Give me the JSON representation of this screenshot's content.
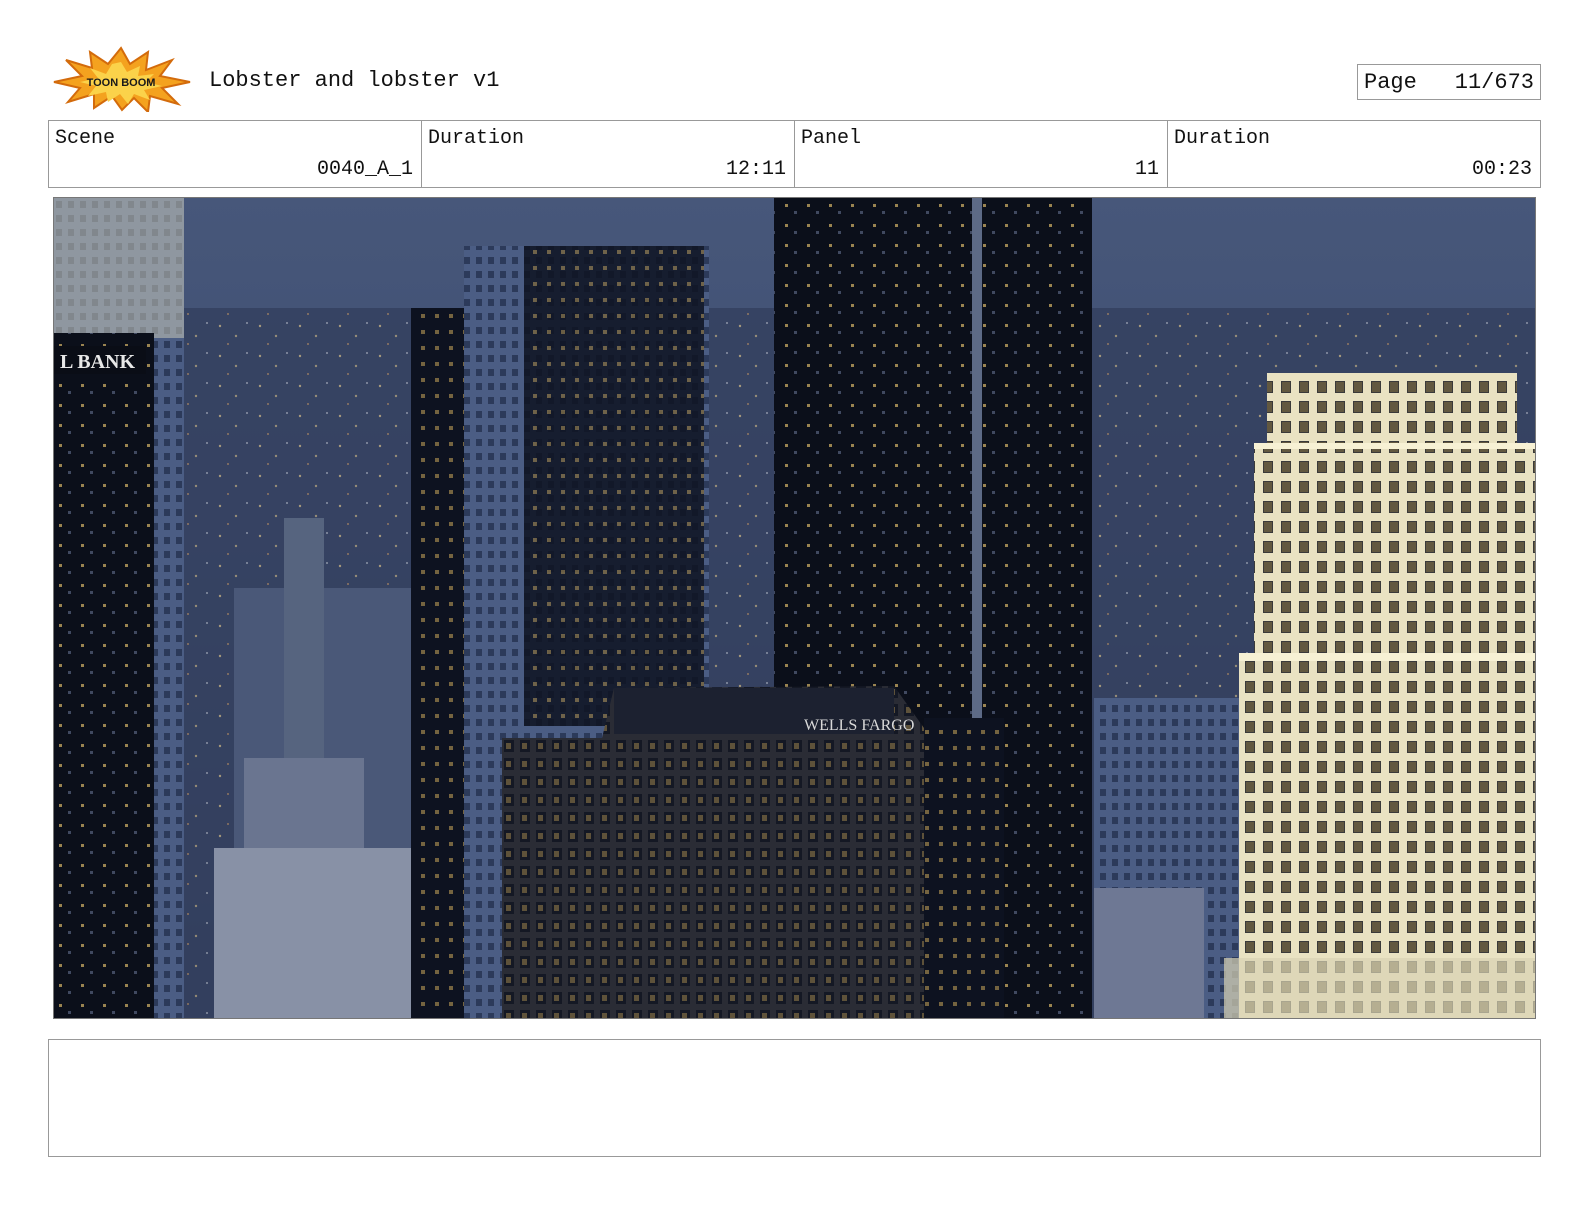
{
  "header": {
    "logo_text": "TOON BOOM",
    "title": "Lobster and lobster v1",
    "page_label": "Page",
    "page_value": "11/673"
  },
  "info": {
    "scene_label": "Scene",
    "scene_value": "0040_A_1",
    "duration_label": "Duration",
    "duration_value": "12:11",
    "panel_label": "Panel",
    "panel_value": "11",
    "panel_duration_label": "Duration",
    "panel_duration_value": "00:23"
  },
  "panel_image": {
    "subject": "city-skyline-night-photo"
  },
  "notes": {
    "text": ""
  }
}
